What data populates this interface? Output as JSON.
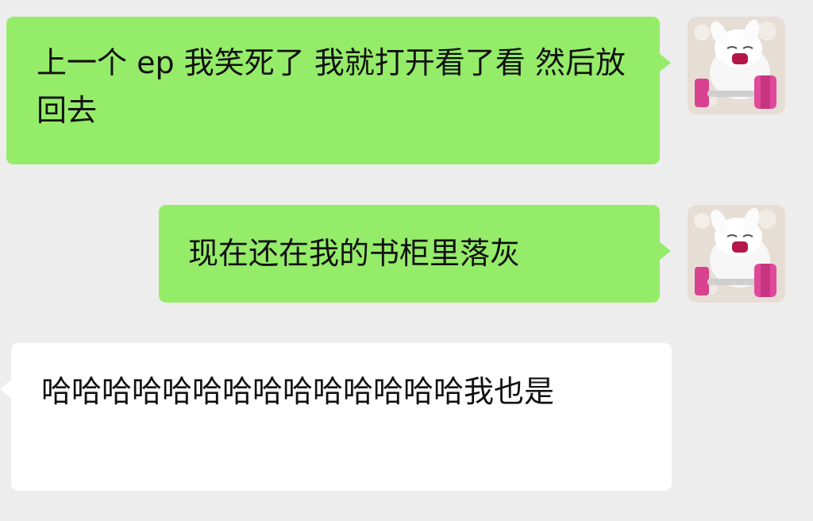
{
  "colors": {
    "background": "#ededed",
    "sent_bubble": "#95ec69",
    "received_bubble": "#ffffff",
    "text": "#111111"
  },
  "messages": [
    {
      "side": "sent",
      "text": "上一个 ep 我笑死了 我就打开看了看 然后放回去",
      "avatar": "bunny-dumbbell-avatar"
    },
    {
      "side": "sent",
      "text": "现在还在我的书柜里落灰",
      "avatar": "bunny-dumbbell-avatar"
    },
    {
      "side": "received",
      "text": "哈哈哈哈哈哈哈哈哈哈哈哈哈哈我也是"
    }
  ]
}
